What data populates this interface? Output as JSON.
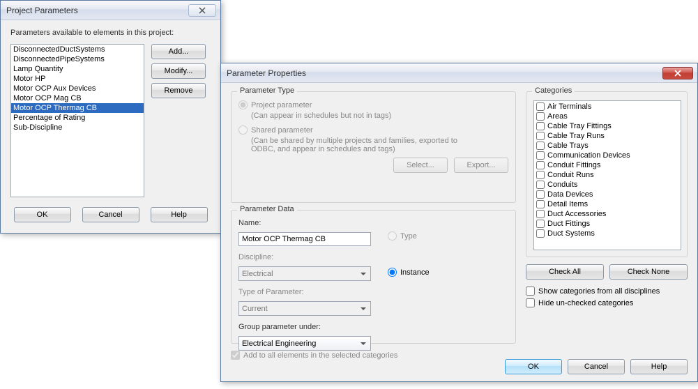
{
  "dlg1": {
    "title": "Project Parameters",
    "avail_label": "Parameters available to elements in this project:",
    "items": [
      "DisconnectedDuctSystems",
      "DisconnectedPipeSystems",
      "Lamp Quantity",
      "Motor HP",
      "Motor OCP Aux Devices",
      "Motor OCP Mag CB",
      "Motor OCP Thermag CB",
      "Percentage of Rating",
      "Sub-Discipline"
    ],
    "selected_index": 6,
    "btn_add": "Add...",
    "btn_modify": "Modify...",
    "btn_remove": "Remove",
    "btn_ok": "OK",
    "btn_cancel": "Cancel",
    "btn_help": "Help"
  },
  "dlg2": {
    "title": "Parameter Properties",
    "ptype": {
      "group": "Parameter Type",
      "project": "Project parameter",
      "project_hint": "(Can appear in schedules but not in tags)",
      "shared": "Shared parameter",
      "shared_hint": "(Can be shared by multiple projects and families, exported to ODBC, and appear in schedules and tags)",
      "btn_select": "Select...",
      "btn_export": "Export..."
    },
    "pdata": {
      "group": "Parameter Data",
      "name_label": "Name:",
      "name_value": "Motor OCP Thermag CB",
      "discipline_label": "Discipline:",
      "discipline_value": "Electrical",
      "typeparam_label": "Type of Parameter:",
      "typeparam_value": "Current",
      "groupunder_label": "Group parameter under:",
      "groupunder_value": "Electrical Engineering",
      "radio_type": "Type",
      "radio_instance": "Instance"
    },
    "cats": {
      "group": "Categories",
      "items": [
        "Air Terminals",
        "Areas",
        "Cable Tray Fittings",
        "Cable Tray Runs",
        "Cable Trays",
        "Communication Devices",
        "Conduit Fittings",
        "Conduit Runs",
        "Conduits",
        "Data Devices",
        "Detail Items",
        "Duct Accessories",
        "Duct Fittings",
        "Duct Systems"
      ],
      "btn_checkall": "Check All",
      "btn_checknone": "Check None",
      "show_all": "Show categories from all disciplines",
      "hide_unchecked": "Hide un-checked categories"
    },
    "add_all": "Add to all elements in the selected categories",
    "btn_ok": "OK",
    "btn_cancel": "Cancel",
    "btn_help": "Help"
  }
}
